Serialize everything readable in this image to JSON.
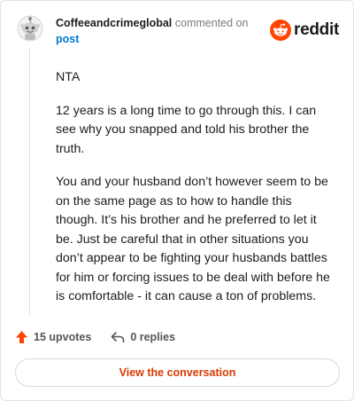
{
  "comment": {
    "username": "Coffeeandcrimeglobal",
    "action_text": "commented on",
    "post_link": "post",
    "paragraphs": [
      "NTA",
      "12 years is a long time to go through this. I can see why you snapped and told his brother the truth.",
      "You and your husband don’t however seem to be on the same page as to how to handle this though. It’s his brother and he preferred to let it be. Just be careful that in other situations you don’t appear to be fighting your husbands battles for him or forcing issues to be deal with before he is comfortable - it can cause a ton of problems."
    ]
  },
  "brand": {
    "name": "reddit",
    "color": "#ff4500"
  },
  "stats": {
    "upvotes": "15 upvotes",
    "replies": "0 replies"
  },
  "cta": {
    "label": "View the conversation",
    "color": "#d93a00"
  },
  "icons": {
    "avatar": "snoo-avatar-icon",
    "upvote": "upvote-arrow-icon",
    "reply": "reply-arrow-icon",
    "logo": "reddit-alien-icon"
  }
}
